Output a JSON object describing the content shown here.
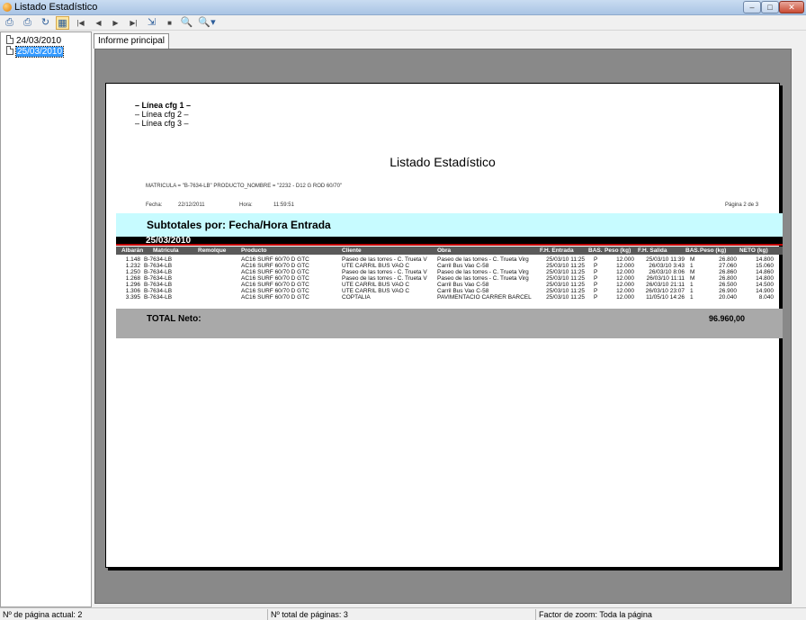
{
  "window": {
    "title": "Listado Estadístico",
    "min": "–",
    "max": "□",
    "close": "✕"
  },
  "toolbar": {
    "icons": [
      "print-icon",
      "print-setup-icon",
      "refresh-icon",
      "tree-toggle-icon",
      "first-page-icon",
      "prev-page-icon",
      "next-page-icon",
      "last-page-icon",
      "export-icon",
      "stop-icon",
      "search-icon",
      "search-options-icon"
    ]
  },
  "tree": {
    "items": [
      {
        "label": "24/03/2010",
        "selected": false
      },
      {
        "label": "25/03/2010",
        "selected": true
      }
    ]
  },
  "tabs": [
    {
      "label": "Informe principal"
    }
  ],
  "report": {
    "header_lines": [
      "– Línea cfg 1 –",
      "– Línea cfg 2 –",
      "– Línea cfg 3 –"
    ],
    "title": "Listado Estadístico",
    "filter": "MATRICULA = \"B-7634-LB\" PRODUCTO_NOMBRE = \"2232 - D12 G  ROD 60/70\"",
    "fecha_label": "Fecha:",
    "fecha": "22/12/2011",
    "hora_label": "Hora:",
    "hora": "11:59:51",
    "pagina": "Página 2 de 3",
    "subtotales": "Subtotales por: Fecha/Hora Entrada",
    "group_date": "25/03/2010",
    "columns": [
      "Albarán",
      "Matrícula",
      "Remolque",
      "Producto",
      "Cliente",
      "Obra",
      "F.H. Entrada",
      "BAS.",
      "Peso (kg)",
      "F.H. Salida",
      "BAS.",
      "Peso (kg)",
      "NETO (kg)"
    ],
    "rows": [
      [
        "1.148",
        "B-7634-LB",
        "",
        "AC16 SURF 60/70 D GTC",
        "Paseo de las torres - C. Trueta V",
        "Paseo de las torres - C. Trueta Virg",
        "25/03/10 11:25",
        "P",
        "12.000",
        "25/03/10 11:39",
        "M",
        "26.800",
        "14.800"
      ],
      [
        "1.232",
        "B-7634-LB",
        "",
        "AC16 SURF 60/70 D GTC",
        "UTE CARRIL BUS VAO C",
        "Carril Bus Vao C-58",
        "25/03/10 11:25",
        "P",
        "12.000",
        "26/03/10  3:43",
        "1",
        "27.060",
        "15.060"
      ],
      [
        "1.250",
        "B-7634-LB",
        "",
        "AC16 SURF 60/70 D GTC",
        "Paseo de las torres - C. Trueta V",
        "Paseo de las torres - C. Trueta Virg",
        "25/03/10 11:25",
        "P",
        "12.000",
        "26/03/10  8:06",
        "M",
        "26.860",
        "14.860"
      ],
      [
        "1.268",
        "B-7634-LB",
        "",
        "AC16 SURF 60/70 D GTC",
        "Paseo de las torres - C. Trueta V",
        "Paseo de las torres - C. Trueta Virg",
        "25/03/10 11:25",
        "P",
        "12.000",
        "26/03/10 11:11",
        "M",
        "26.800",
        "14.800"
      ],
      [
        "1.296",
        "B-7634-LB",
        "",
        "AC16 SURF 60/70 D GTC",
        "UTE CARRIL BUS VAO C",
        "Carril Bus Vao C-58",
        "25/03/10 11:25",
        "P",
        "12.000",
        "26/03/10 21:11",
        "1",
        "26.500",
        "14.500"
      ],
      [
        "1.306",
        "B-7634-LB",
        "",
        "AC16 SURF 60/70 D GTC",
        "UTE CARRIL BUS VAO C",
        "Carril Bus Vao C-58",
        "25/03/10 11:25",
        "P",
        "12.000",
        "26/03/10 23:07",
        "1",
        "26.900",
        "14.900"
      ],
      [
        "3.395",
        "B-7634-LB",
        "",
        "AC16 SURF 60/70 D GTC",
        "COPTALIA",
        "PAVIMENTACIO CARRER BARCEL",
        "25/03/10 11:25",
        "P",
        "12.000",
        "11/05/10 14:26",
        "1",
        "20.040",
        "8.040"
      ]
    ],
    "total_label": "TOTAL Neto:",
    "total_value": "96.960,00"
  },
  "status": {
    "page_current": "Nº de página actual: 2",
    "page_total": "Nº total de páginas: 3",
    "zoom": "Factor de zoom: Toda la página"
  },
  "colors": {
    "subtotal_bg": "#c7fbff",
    "group_line": "#c00000",
    "header_bg": "#5a5a5a",
    "total_bg": "#a9a9a9",
    "viewer_bg": "#898989"
  }
}
